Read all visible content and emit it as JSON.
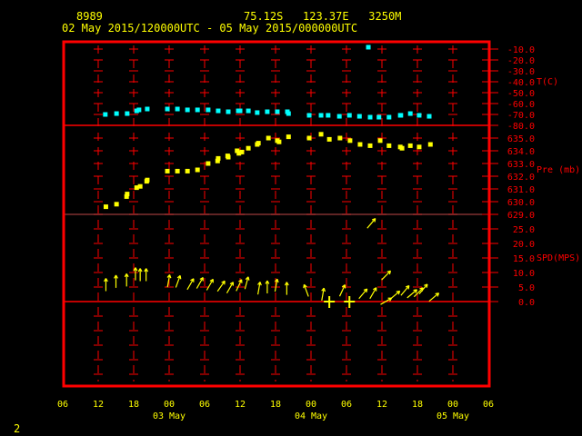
{
  "header": {
    "station_id": "8989",
    "location": "75.12S   123.37E   3250M",
    "time_range": "02 May 2015/120000UTC - 05 May 2015/000000UTC"
  },
  "footer": {
    "page_number": "2"
  },
  "colors": {
    "frame": "#ff0000",
    "temperature": "#00ffff",
    "pressure": "#ffff00",
    "wind": "#ffff00",
    "text": "#ffff00"
  },
  "chart_data": {
    "type": "scatter",
    "x_unit": "hours since 02 May 2015 06UTC",
    "x_range": [
      0,
      72
    ],
    "x_ticks": [
      "06",
      "12",
      "18",
      "00",
      "06",
      "12",
      "18",
      "00",
      "06",
      "12",
      "18",
      "00",
      "06"
    ],
    "date_labels": [
      {
        "label": "03 May",
        "at_hour": 18
      },
      {
        "label": "04 May",
        "at_hour": 42
      },
      {
        "label": "05 May",
        "at_hour": 66
      }
    ],
    "panels": [
      {
        "name": "temperature",
        "label": "T(C)",
        "ylim": [
          -80,
          -10
        ],
        "ticks": [
          "-10.0",
          "-20.0",
          "-30.0",
          "-40.0",
          "-50.0",
          "-60.0",
          "-70.0",
          "-80.0"
        ],
        "points": [
          [
            7.2,
            -70
          ],
          [
            9.1,
            -69.2
          ],
          [
            10.9,
            -69.2
          ],
          [
            12.5,
            -66.7
          ],
          [
            12.9,
            -65.8
          ],
          [
            14.3,
            -65
          ],
          [
            17.7,
            -65
          ],
          [
            19.4,
            -65
          ],
          [
            21.1,
            -65.8
          ],
          [
            22.8,
            -65.8
          ],
          [
            24.6,
            -65.8
          ],
          [
            26.3,
            -66.7
          ],
          [
            28,
            -67.5
          ],
          [
            29.7,
            -66.7
          ],
          [
            30,
            -66.7
          ],
          [
            31.4,
            -66.7
          ],
          [
            32.9,
            -68.3
          ],
          [
            34.6,
            -67.5
          ],
          [
            36.3,
            -67.5
          ],
          [
            38,
            -67.5
          ],
          [
            38.2,
            -69.2
          ],
          [
            41.7,
            -70.8
          ],
          [
            43.7,
            -70.8
          ],
          [
            44.9,
            -70.8
          ],
          [
            46.8,
            -71.7
          ],
          [
            48.5,
            -70.8
          ],
          [
            50.2,
            -71.7
          ],
          [
            52,
            -72.5
          ],
          [
            53.5,
            -72.5
          ],
          [
            55.2,
            -72.5
          ],
          [
            57.1,
            -70.8
          ],
          [
            57.2,
            -70.8
          ],
          [
            58.8,
            -69.2
          ],
          [
            60.3,
            -70.8
          ],
          [
            62,
            -71.7
          ],
          [
            51.7,
            -8.3
          ]
        ]
      },
      {
        "name": "pressure",
        "label": "Pre (mb)",
        "ylim": [
          629,
          635
        ],
        "ticks": [
          "635.0",
          "634.0",
          "633.0",
          "632.0",
          "631.0",
          "630.0",
          "629.0"
        ],
        "points": [
          [
            7.3,
            629.6
          ],
          [
            9.1,
            629.8
          ],
          [
            10.8,
            630.4
          ],
          [
            10.9,
            630.6
          ],
          [
            12.5,
            631.1
          ],
          [
            13.1,
            631.2
          ],
          [
            14.2,
            631.6
          ],
          [
            14.3,
            631.7
          ],
          [
            17.7,
            632.4
          ],
          [
            19.4,
            632.4
          ],
          [
            21.1,
            632.4
          ],
          [
            22.8,
            632.5
          ],
          [
            24.6,
            633.0
          ],
          [
            26.2,
            633.2
          ],
          [
            26.3,
            633.4
          ],
          [
            27.9,
            633.6
          ],
          [
            28.0,
            633.5
          ],
          [
            29.5,
            634.0
          ],
          [
            29.8,
            633.8
          ],
          [
            30.3,
            633.9
          ],
          [
            31.4,
            634.2
          ],
          [
            32.9,
            634.5
          ],
          [
            33.1,
            634.6
          ],
          [
            34.8,
            635.0
          ],
          [
            36.3,
            634.8
          ],
          [
            36.6,
            634.7
          ],
          [
            38.2,
            635.1
          ],
          [
            41.7,
            635.0
          ],
          [
            43.7,
            635.3
          ],
          [
            45.1,
            634.9
          ],
          [
            46.9,
            635.0
          ],
          [
            48.6,
            634.8
          ],
          [
            50.3,
            634.5
          ],
          [
            52.0,
            634.4
          ],
          [
            53.7,
            634.8
          ],
          [
            55.2,
            634.4
          ],
          [
            57.1,
            634.3
          ],
          [
            57.4,
            634.2
          ],
          [
            58.8,
            634.4
          ],
          [
            60.3,
            634.3
          ],
          [
            62.2,
            634.5
          ]
        ]
      },
      {
        "name": "wind",
        "label": "SPD(MPS)",
        "ylim": [
          0,
          25
        ],
        "ticks": [
          "25.0",
          "20.0",
          "15.0",
          "10.0",
          "5.0",
          "0.0"
        ],
        "points_hour_speed_dir": [
          [
            7.3,
            5.8,
            0
          ],
          [
            9.0,
            6.9,
            0
          ],
          [
            10.8,
            7.4,
            0
          ],
          [
            12.3,
            9.5,
            0
          ],
          [
            13.1,
            9.2,
            0
          ],
          [
            14.1,
            9.2,
            0
          ],
          [
            17.9,
            7.1,
            10
          ],
          [
            19.5,
            6.9,
            20
          ],
          [
            21.6,
            6.0,
            30
          ],
          [
            23.2,
            6.4,
            30
          ],
          [
            24.9,
            5.8,
            30
          ],
          [
            26.8,
            5.3,
            35
          ],
          [
            28.3,
            4.8,
            30
          ],
          [
            29.8,
            5.6,
            25
          ],
          [
            31.1,
            6.4,
            15
          ],
          [
            33.2,
            4.6,
            10
          ],
          [
            34.6,
            5.0,
            0
          ],
          [
            36.1,
            5.6,
            10
          ],
          [
            37.9,
            4.5,
            0
          ],
          [
            41.2,
            3.8,
            -20
          ],
          [
            44.0,
            2.5,
            10
          ],
          [
            47.3,
            3.8,
            25
          ],
          [
            50.8,
            2.7,
            40
          ],
          [
            52.5,
            2.9,
            30
          ],
          [
            54.7,
            9.0,
            45
          ],
          [
            52.2,
            26.9,
            40
          ],
          [
            54.7,
            0.1,
            60
          ],
          [
            56.2,
            2.2,
            50
          ],
          [
            57.9,
            3.8,
            40
          ],
          [
            59.1,
            2.7,
            50
          ],
          [
            60.2,
            3.2,
            45
          ],
          [
            61.0,
            4.3,
            40
          ],
          [
            62.8,
            1.5,
            50
          ]
        ],
        "calm_hours": [
          45.1,
          48.5
        ]
      }
    ]
  }
}
